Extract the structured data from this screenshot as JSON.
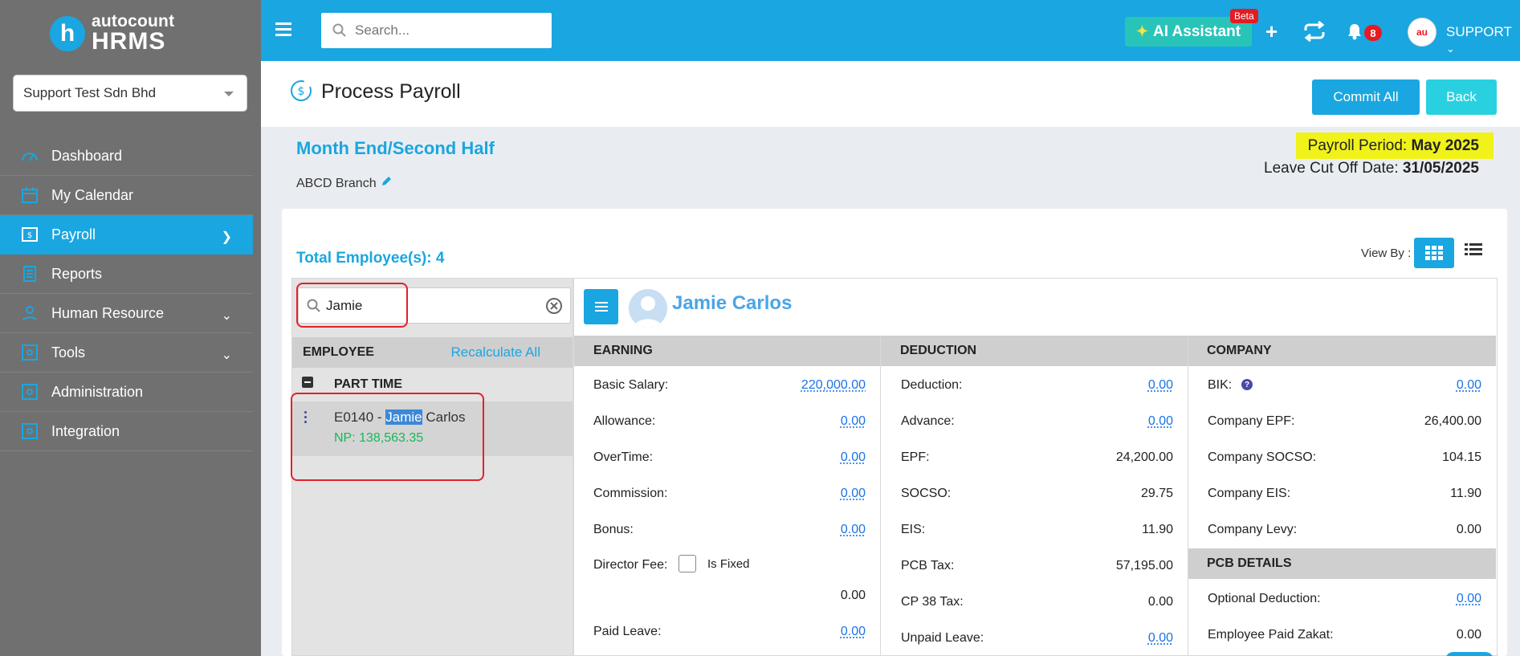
{
  "brand": {
    "logo_letter": "h",
    "name_small": "autocount",
    "name_big": "HRMS"
  },
  "company": {
    "selected": "Support Test Sdn Bhd"
  },
  "sidebar": {
    "items": [
      {
        "label": "Dashboard",
        "icon": "dashboard-icon"
      },
      {
        "label": "My Calendar",
        "icon": "calendar-icon"
      },
      {
        "label": "Payroll",
        "icon": "payroll-icon",
        "active": true
      },
      {
        "label": "Reports",
        "icon": "reports-icon"
      },
      {
        "label": "Human Resource",
        "icon": "human-resource-icon"
      },
      {
        "label": "Tools",
        "icon": "tools-icon"
      },
      {
        "label": "Administration",
        "icon": "administration-icon"
      },
      {
        "label": "Integration",
        "icon": "integration-icon"
      }
    ]
  },
  "topbar": {
    "search_placeholder": "Search...",
    "ai_label": "AI Assistant",
    "beta": "Beta",
    "notif_count": "8",
    "avatar_text": "au",
    "user": "SUPPORT"
  },
  "page": {
    "title": "Process Payroll",
    "commit_label": "Commit All",
    "back_label": "Back",
    "period_title": "Month End/Second Half",
    "branch": "ABCD Branch",
    "payroll_period_label": "Payroll Period: ",
    "payroll_period_value": "May 2025",
    "cutoff_label": "Leave Cut Off Date: ",
    "cutoff_value": "31/05/2025",
    "total_employees": "Total Employee(s): 4",
    "view_by": "View By :"
  },
  "employee_panel": {
    "search_value": "Jamie",
    "header": "EMPLOYEE",
    "recalculate": "Recalculate All",
    "group": "PART TIME",
    "employee": {
      "code_prefix": "E0140 - ",
      "first_name": "Jamie",
      "last_name": " Carlos",
      "np": "NP: 138,563.35"
    }
  },
  "detail": {
    "name": "Jamie Carlos",
    "earning": {
      "header": "EARNING",
      "basic_label": "Basic Salary:",
      "basic": "220,000.00",
      "allowance_label": "Allowance:",
      "allowance": "0.00",
      "overtime_label": "OverTime:",
      "overtime": "0.00",
      "commission_label": "Commission:",
      "commission": "0.00",
      "bonus_label": "Bonus:",
      "bonus": "0.00",
      "director_label": "Director Fee:",
      "is_fixed": "Is Fixed",
      "director": "0.00",
      "paid_leave_label": "Paid Leave:",
      "paid_leave": "0.00"
    },
    "deduction": {
      "header": "DEDUCTION",
      "deduction_label": "Deduction:",
      "deduction": "0.00",
      "advance_label": "Advance:",
      "advance": "0.00",
      "epf_label": "EPF:",
      "epf": "24,200.00",
      "socso_label": "SOCSO:",
      "socso": "29.75",
      "eis_label": "EIS:",
      "eis": "11.90",
      "pcb_label": "PCB Tax:",
      "pcb": "57,195.00",
      "cp38_label": "CP 38 Tax:",
      "cp38": "0.00",
      "unpaid_label": "Unpaid Leave:",
      "unpaid": "0.00"
    },
    "company": {
      "header": "COMPANY",
      "bik_label": "BIK:",
      "bik": "0.00",
      "epf_label": "Company EPF:",
      "epf": "26,400.00",
      "socso_label": "Company SOCSO:",
      "socso": "104.15",
      "eis_label": "Company EIS:",
      "eis": "11.90",
      "levy_label": "Company Levy:",
      "levy": "0.00",
      "pcb_header": "PCB DETAILS",
      "optional_label": "Optional Deduction:",
      "optional": "0.00",
      "zakat_label": "Employee Paid Zakat:",
      "zakat": "0.00"
    }
  },
  "colors": {
    "accent": "#1aa6e0",
    "sidebar": "#707070",
    "highlight": "#f0f21a",
    "np_green": "#15b85a"
  }
}
